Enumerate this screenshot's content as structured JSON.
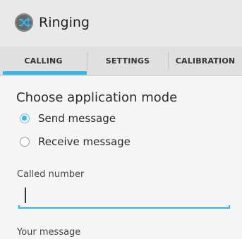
{
  "app": {
    "title": "Ringing",
    "icon": "shuffle-icon"
  },
  "tabs": [
    {
      "label": "CALLING",
      "active": true
    },
    {
      "label": "SETTINGS",
      "active": false
    },
    {
      "label": "CALIBRATION",
      "active": false
    }
  ],
  "mode": {
    "title": "Choose application mode",
    "options": [
      {
        "label": "Send message",
        "checked": true
      },
      {
        "label": "Receive message",
        "checked": false
      }
    ]
  },
  "form": {
    "called_number_label": "Called number",
    "called_number_value": "",
    "message_label": "Your message"
  },
  "colors": {
    "accent": "#33b5e5"
  }
}
